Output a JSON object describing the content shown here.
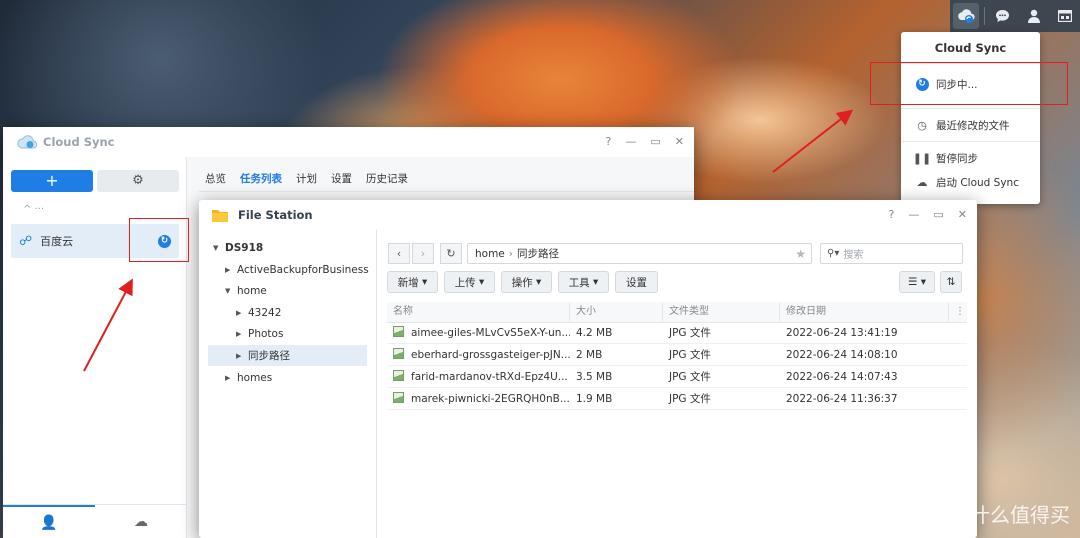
{
  "tray": {
    "icons": [
      "cloud-sync-icon",
      "chat-icon",
      "user-icon",
      "widgets-icon"
    ]
  },
  "cloud_sync_menu": {
    "title": "Cloud Sync",
    "syncing": "同步中...",
    "recent_files": "最近修改的文件",
    "pause": "暂停同步",
    "launch": "启动 Cloud Sync"
  },
  "cloud_sync_window": {
    "title": "Cloud Sync",
    "controls": [
      "?",
      "—",
      "▭",
      "✕"
    ],
    "add_label": "+",
    "group_label": "^ ···",
    "connection_name": "百度云",
    "tabs": [
      "总览",
      "任务列表",
      "计划",
      "设置",
      "历史记录"
    ],
    "active_tab": "任务列表"
  },
  "file_station": {
    "title": "File Station",
    "tree": {
      "root": "DS918",
      "items": [
        "ActiveBackupforBusiness",
        "home",
        "43242",
        "Photos",
        "同步路径",
        "homes"
      ]
    },
    "path": [
      "home",
      "同步路径"
    ],
    "search_placeholder": "搜索",
    "toolbar": [
      "新增",
      "上传",
      "操作",
      "工具",
      "设置"
    ],
    "columns": [
      "名称",
      "大小",
      "文件类型",
      "修改日期"
    ],
    "files": [
      {
        "name": "aimee-giles-MLvCvS5eX-Y-un...",
        "size": "4.2 MB",
        "type": "JPG 文件",
        "modified": "2022-06-24 13:41:19"
      },
      {
        "name": "eberhard-grossgasteiger-pJN...",
        "size": "2 MB",
        "type": "JPG 文件",
        "modified": "2022-06-24 14:08:10"
      },
      {
        "name": "farid-mardanov-tRXd-Epz4U...",
        "size": "3.5 MB",
        "type": "JPG 文件",
        "modified": "2022-06-24 14:07:43"
      },
      {
        "name": "marek-piwnicki-2EGRQH0nB...",
        "size": "1.9 MB",
        "type": "JPG 文件",
        "modified": "2022-06-24 11:36:37"
      }
    ]
  },
  "watermark": "什么值得买",
  "colors": {
    "accent": "#1f7de6",
    "annotation": "#e02020"
  }
}
